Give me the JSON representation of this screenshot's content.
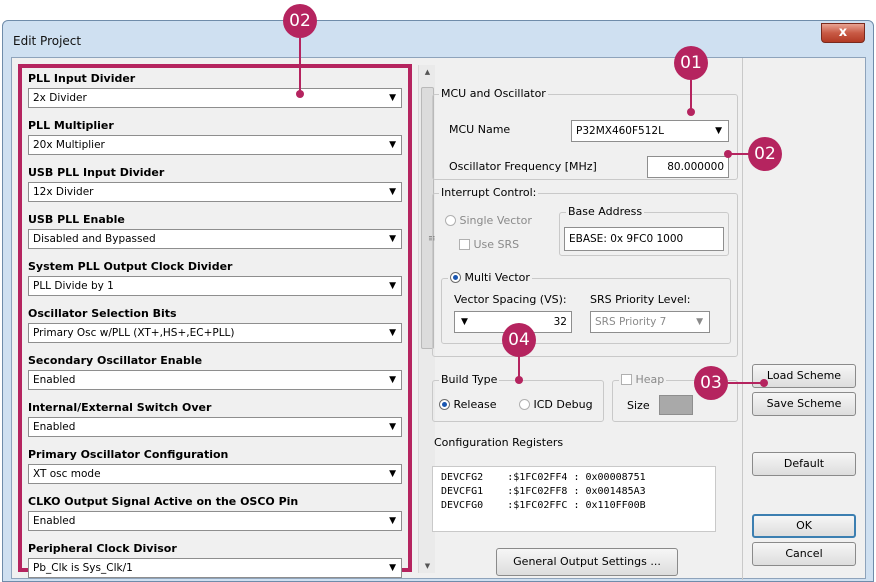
{
  "window": {
    "title": "Edit Project",
    "close_label": "x"
  },
  "properties": [
    {
      "label": "PLL Input Divider",
      "value": "2x Divider"
    },
    {
      "label": "PLL Multiplier",
      "value": "20x Multiplier"
    },
    {
      "label": "USB PLL Input Divider",
      "value": "12x Divider"
    },
    {
      "label": "USB PLL Enable",
      "value": "Disabled and Bypassed"
    },
    {
      "label": "System PLL Output Clock Divider",
      "value": "PLL Divide by 1"
    },
    {
      "label": "Oscillator Selection Bits",
      "value": "Primary Osc w/PLL (XT+,HS+,EC+PLL)"
    },
    {
      "label": "Secondary Oscillator Enable",
      "value": "Enabled"
    },
    {
      "label": "Internal/External Switch Over",
      "value": "Enabled"
    },
    {
      "label": "Primary Oscillator Configuration",
      "value": "XT osc mode"
    },
    {
      "label": "CLKO Output Signal Active on the OSCO Pin",
      "value": "Enabled"
    },
    {
      "label": "Peripheral Clock Divisor",
      "value": "Pb_Clk is Sys_Clk/1"
    }
  ],
  "mcu": {
    "group_title": "MCU and Oscillator",
    "name_label": "MCU Name",
    "name_value": "P32MX460F512L",
    "freq_label": "Oscillator Frequency [MHz]",
    "freq_value": "80.000000"
  },
  "interrupt": {
    "group_title": "Interrupt Control:",
    "single_vector": "Single Vector",
    "use_srs": "Use SRS",
    "base_address_title": "Base Address",
    "base_address_value": "EBASE: 0x 9FC0 1000",
    "multi_vector": "Multi Vector",
    "vector_spacing_label": "Vector Spacing (VS):",
    "vector_spacing_value": "32",
    "srs_priority_label": "SRS Priority Level:",
    "srs_priority_value": "SRS Priority 7"
  },
  "build": {
    "group_title": "Build Type",
    "release": "Release",
    "icd_debug": "ICD Debug",
    "heap_title": "Heap",
    "heap_size_label": "Size"
  },
  "config_registers": {
    "group_title": "Configuration Registers",
    "rows": [
      "DEVCFG2    :$1FC02FF4 : 0x00008751",
      "DEVCFG1    :$1FC02FF8 : 0x001485A3",
      "DEVCFG0    :$1FC02FFC : 0x110FF00B"
    ]
  },
  "buttons": {
    "general_output": "General Output Settings ...",
    "load_scheme": "Load Scheme",
    "save_scheme": "Save Scheme",
    "default": "Default",
    "ok": "OK",
    "cancel": "Cancel"
  },
  "badges": {
    "b1": "01",
    "b2_top": "02",
    "b2_right": "02",
    "b3": "03",
    "b4": "04"
  },
  "colors": {
    "accent": "#b5245f",
    "window_frame": "#cfe0f1",
    "dialog_bg": "#f0f0f0"
  }
}
